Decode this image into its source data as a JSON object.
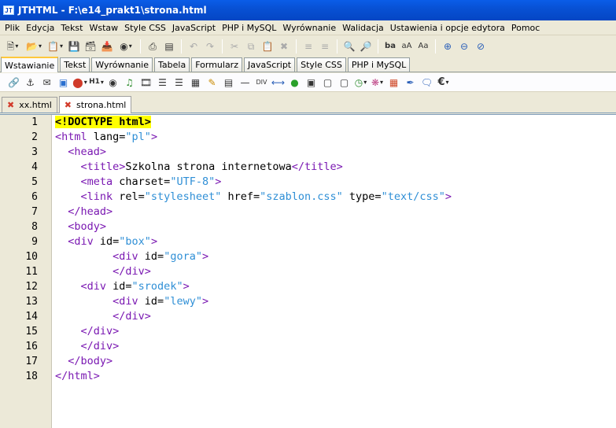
{
  "window": {
    "title": "JTHTML - F:\\e14_prakt1\\strona.html",
    "app_icon": "JT"
  },
  "menu": [
    "Plik",
    "Edycja",
    "Tekst",
    "Wstaw",
    "Style CSS",
    "JavaScript",
    "PHP i MySQL",
    "Wyrównanie",
    "Walidacja",
    "Ustawienia i opcje edytora",
    "Pomoc"
  ],
  "toolbar": {
    "icons": [
      "new-file-icon",
      "open-folder-icon",
      "open-recent-icon",
      "save-icon",
      "save-all-icon",
      "save-as-icon",
      "preview-icon",
      "print-icon",
      "print-preview-icon",
      "undo-icon",
      "redo-icon",
      "cut-icon",
      "copy-icon",
      "paste-icon",
      "delete-icon",
      "indent-left-icon",
      "indent-right-icon",
      "find-icon",
      "replace-icon",
      "text-case-icon",
      "font-larger-icon",
      "font-smaller-icon",
      "zoom-in-icon",
      "zoom-out-icon",
      "zoom-reset-icon"
    ],
    "text_case_label": "ba",
    "font_up_label": "aA",
    "font_down_label": "Aa"
  },
  "ribbon_tabs": [
    "Wstawianie",
    "Tekst",
    "Wyrównanie",
    "Tabela",
    "Formularz",
    "JavaScript",
    "Style CSS",
    "PHP i MySQL"
  ],
  "ribbon_active": 0,
  "insert_tools": {
    "icons": [
      "link-icon",
      "anchor-icon",
      "email-icon",
      "image-icon",
      "color-icon",
      "heading-icon",
      "circle-icon",
      "music-icon",
      "film-icon",
      "ordered-list-icon",
      "unordered-list-icon",
      "table-icon",
      "edit-icon",
      "form-icon",
      "hr-icon",
      "div-icon",
      "arrows-icon",
      "green-dot-icon",
      "frame-icon",
      "layers-icon",
      "window-icon",
      "clock-icon",
      "palette-icon",
      "grid-icon",
      "eyedropper-icon",
      "comment-icon",
      "euro-icon"
    ],
    "heading_label": "H1",
    "div_label": "DIV",
    "euro_label": "€"
  },
  "files": [
    {
      "name": "xx.html",
      "active": false
    },
    {
      "name": "strona.html",
      "active": true
    }
  ],
  "code_lines": [
    [
      {
        "t": "hl",
        "v": "<!DOCTYPE html>"
      }
    ],
    [
      {
        "t": "tag",
        "v": "<html"
      },
      {
        "t": "attr",
        "v": " lang="
      },
      {
        "t": "str",
        "v": "\"pl\""
      },
      {
        "t": "tag",
        "v": ">"
      }
    ],
    [
      {
        "t": "ptx",
        "v": "  "
      },
      {
        "t": "tag",
        "v": "<head>"
      }
    ],
    [
      {
        "t": "ptx",
        "v": "    "
      },
      {
        "t": "tag",
        "v": "<title>"
      },
      {
        "t": "ptx",
        "v": "Szkolna strona internetowa"
      },
      {
        "t": "tag",
        "v": "</title>"
      }
    ],
    [
      {
        "t": "ptx",
        "v": "    "
      },
      {
        "t": "tag",
        "v": "<meta"
      },
      {
        "t": "attr",
        "v": " charset="
      },
      {
        "t": "str",
        "v": "\"UTF-8\""
      },
      {
        "t": "tag",
        "v": ">"
      }
    ],
    [
      {
        "t": "ptx",
        "v": "    "
      },
      {
        "t": "tag",
        "v": "<link"
      },
      {
        "t": "attr",
        "v": " rel="
      },
      {
        "t": "str",
        "v": "\"stylesheet\""
      },
      {
        "t": "attr",
        "v": " href="
      },
      {
        "t": "str",
        "v": "\"szablon.css\""
      },
      {
        "t": "attr",
        "v": " type="
      },
      {
        "t": "str",
        "v": "\"text/css\""
      },
      {
        "t": "tag",
        "v": ">"
      }
    ],
    [
      {
        "t": "ptx",
        "v": "  "
      },
      {
        "t": "tag",
        "v": "</head>"
      }
    ],
    [
      {
        "t": "ptx",
        "v": "  "
      },
      {
        "t": "tag",
        "v": "<body>"
      }
    ],
    [
      {
        "t": "ptx",
        "v": "  "
      },
      {
        "t": "tag",
        "v": "<div"
      },
      {
        "t": "attr",
        "v": " id="
      },
      {
        "t": "str",
        "v": "\"box\""
      },
      {
        "t": "tag",
        "v": ">"
      }
    ],
    [
      {
        "t": "ptx",
        "v": "         "
      },
      {
        "t": "tag",
        "v": "<div"
      },
      {
        "t": "attr",
        "v": " id="
      },
      {
        "t": "str",
        "v": "\"gora\""
      },
      {
        "t": "tag",
        "v": ">"
      }
    ],
    [
      {
        "t": "ptx",
        "v": "         "
      },
      {
        "t": "tag",
        "v": "</div>"
      }
    ],
    [
      {
        "t": "ptx",
        "v": "    "
      },
      {
        "t": "tag",
        "v": "<div"
      },
      {
        "t": "attr",
        "v": " id="
      },
      {
        "t": "str",
        "v": "\"srodek\""
      },
      {
        "t": "tag",
        "v": ">"
      }
    ],
    [
      {
        "t": "ptx",
        "v": "         "
      },
      {
        "t": "tag",
        "v": "<div"
      },
      {
        "t": "attr",
        "v": " id="
      },
      {
        "t": "str",
        "v": "\"lewy\""
      },
      {
        "t": "tag",
        "v": ">"
      }
    ],
    [
      {
        "t": "ptx",
        "v": "         "
      },
      {
        "t": "tag",
        "v": "</div>"
      }
    ],
    [
      {
        "t": "ptx",
        "v": "    "
      },
      {
        "t": "tag",
        "v": "</div>"
      }
    ],
    [
      {
        "t": "ptx",
        "v": "    "
      },
      {
        "t": "tag",
        "v": "</div>"
      }
    ],
    [
      {
        "t": "ptx",
        "v": "  "
      },
      {
        "t": "tag",
        "v": "</body>"
      }
    ],
    [
      {
        "t": "tag",
        "v": "</html>"
      }
    ]
  ]
}
